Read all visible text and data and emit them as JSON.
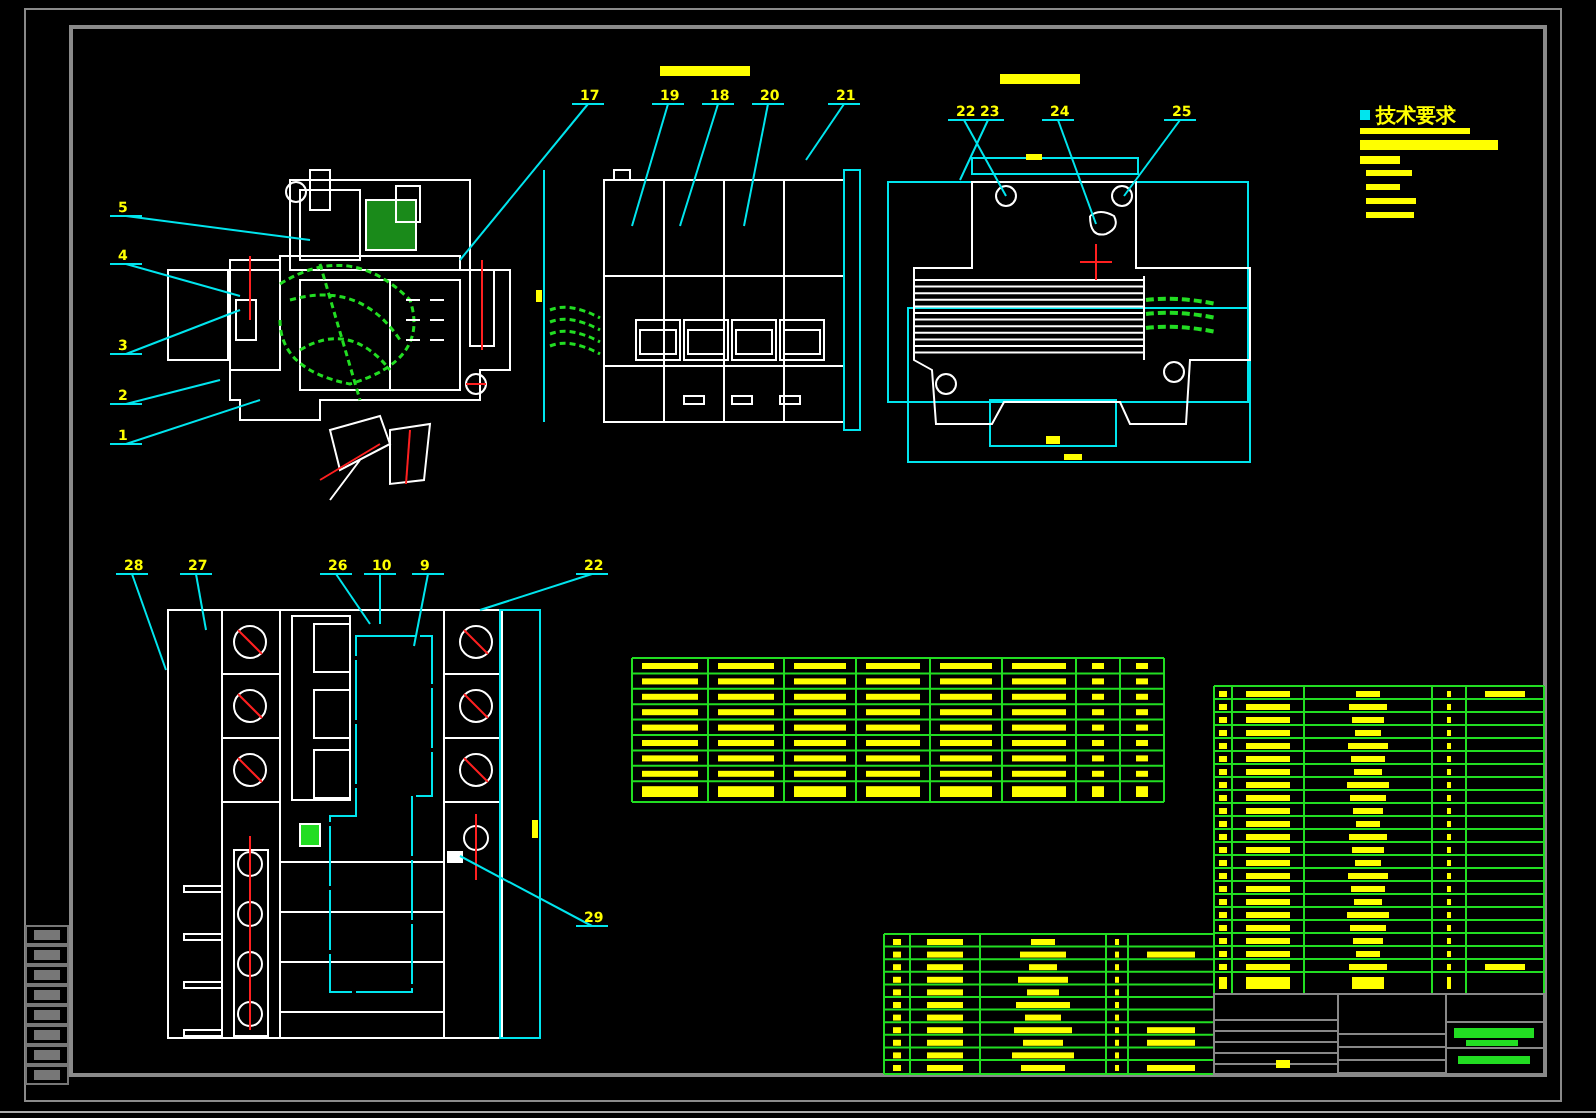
{
  "drawing": {
    "notes_title": "技术要求",
    "balloons": [
      {
        "label": "5"
      },
      {
        "label": "4"
      },
      {
        "label": "3"
      },
      {
        "label": "2"
      },
      {
        "label": "1"
      },
      {
        "label": "17"
      },
      {
        "label": "19"
      },
      {
        "label": "18"
      },
      {
        "label": "20"
      },
      {
        "label": "21"
      },
      {
        "label": "22"
      },
      {
        "label": "23"
      },
      {
        "label": "24"
      },
      {
        "label": "25"
      },
      {
        "label": "28"
      },
      {
        "label": "27"
      },
      {
        "label": "26"
      },
      {
        "label": "10"
      },
      {
        "label": "9"
      },
      {
        "label": "22"
      },
      {
        "label": "29"
      }
    ]
  }
}
